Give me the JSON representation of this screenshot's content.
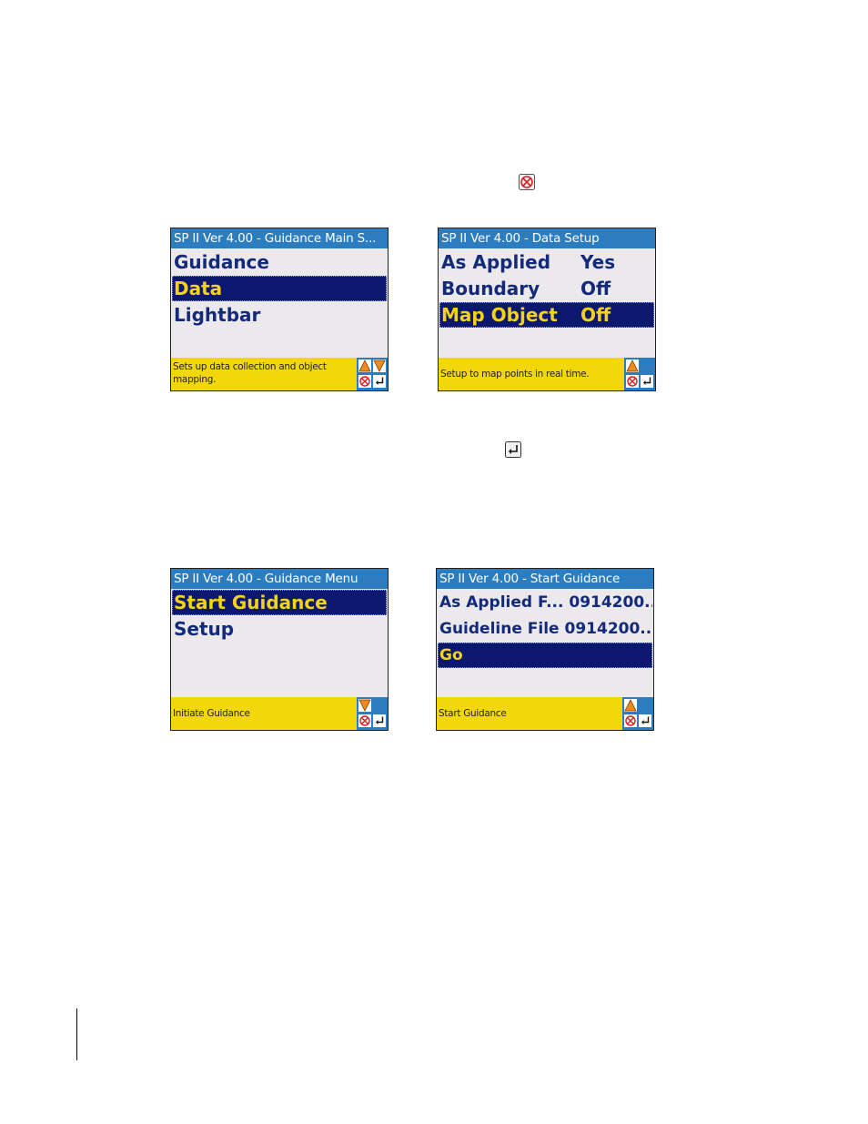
{
  "screens": [
    {
      "title": "SP II Ver 4.00 - Guidance Main S...",
      "rows": [
        {
          "label": "Guidance",
          "value": ""
        },
        {
          "label": "Data",
          "value": ""
        },
        {
          "label": "Lightbar",
          "value": ""
        }
      ],
      "selected_index": 1,
      "status": "Sets up data collection and object mapping.",
      "keys": [
        "up-arrow-icon",
        "down-arrow-icon",
        "cancel-icon",
        "enter-icon"
      ]
    },
    {
      "title": "SP II Ver 4.00 - Data Setup",
      "rows": [
        {
          "label": "As Applied",
          "value": "Yes"
        },
        {
          "label": "Boundary",
          "value": "Off"
        },
        {
          "label": "Map Object",
          "value": "Off"
        }
      ],
      "selected_index": 2,
      "status": "Setup to map points in real time.",
      "keys": [
        "up-arrow-icon",
        "cancel-icon",
        "enter-icon"
      ]
    },
    {
      "title": "SP II Ver 4.00 - Guidance Menu",
      "rows": [
        {
          "label": "Start Guidance",
          "value": ""
        },
        {
          "label": "Setup",
          "value": ""
        }
      ],
      "selected_index": 0,
      "status": "Initiate Guidance",
      "keys": [
        "down-arrow-icon",
        "cancel-icon",
        "enter-icon"
      ]
    },
    {
      "title": "SP II Ver 4.00 - Start Guidance",
      "rows": [
        {
          "label": "As Applied F... 0914200...",
          "value": ""
        },
        {
          "label": "Guideline File 0914200...",
          "value": ""
        },
        {
          "label": "Go",
          "value": ""
        }
      ],
      "selected_index": 2,
      "status": "Start Guidance",
      "keys": [
        "up-arrow-icon",
        "cancel-icon",
        "enter-icon"
      ]
    }
  ],
  "inline_icons": [
    "cancel-icon",
    "enter-icon"
  ],
  "colors": {
    "titlebar": "#2b7dc0",
    "statusbar": "#f3d70d",
    "selected_bg": "#0c176e",
    "selected_text": "#f4d21a",
    "menu_text": "#132a7a",
    "body_bg": "#ece9ec"
  }
}
